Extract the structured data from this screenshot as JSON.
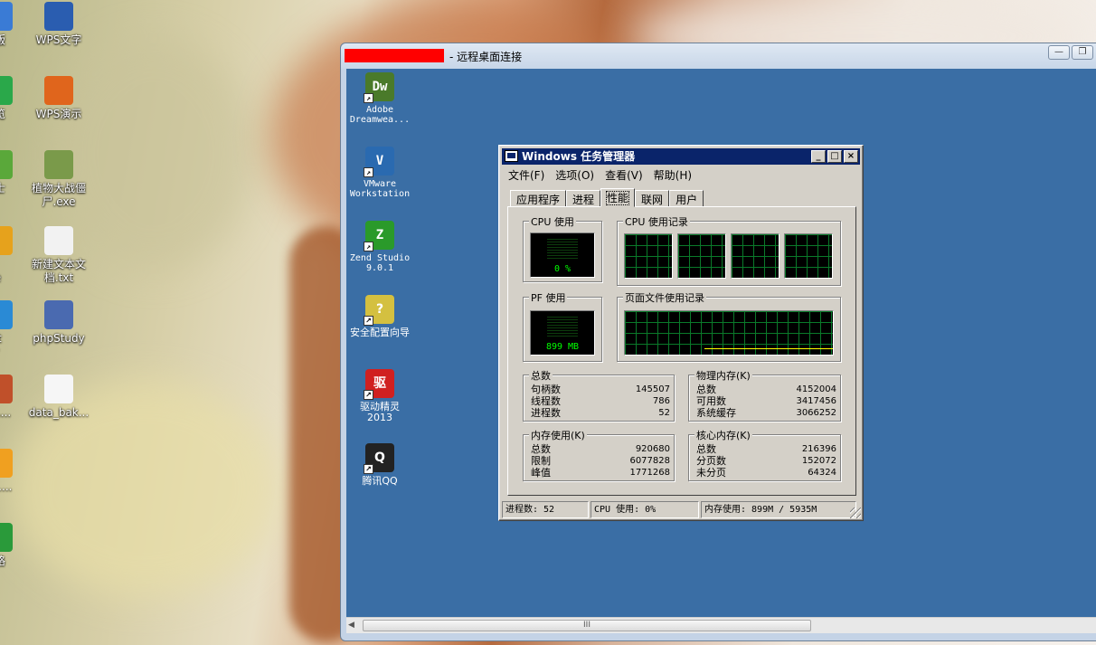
{
  "desktop": {
    "icons": [
      {
        "label": "简版",
        "color": "#3a7bd5"
      },
      {
        "label": "WPS文字",
        "color": "#2a5db0"
      },
      {
        "label": "浏览",
        "color": "#2aa84a"
      },
      {
        "label": "WPS演示",
        "color": "#e0651c"
      },
      {
        "label": "卫士",
        "color": "#5aa83a"
      },
      {
        "label": "植物大战僵尸.exe",
        "color": "#7a9a4a"
      },
      {
        "label": "ile me",
        "color": "#e6a21c"
      },
      {
        "label": "新建文本文档.txt",
        "color": "#f2f2f2"
      },
      {
        "label": "net rer",
        "color": "#2a8ad5"
      },
      {
        "label": "phpStudy",
        "color": "#4a6ab0"
      },
      {
        "label": "ne....",
        "color": "#c0502a"
      },
      {
        "label": "data_bak...",
        "color": "#f6f6f6"
      },
      {
        "label": "sic....",
        "color": "#f0a020"
      },
      {
        "label": "表格",
        "color": "#2a9a3a"
      }
    ]
  },
  "remote_window": {
    "title": "- 远程桌面连接",
    "buttons": {
      "min": "—",
      "max": "❐"
    },
    "icons": [
      {
        "label": "Adobe Dreamwea...",
        "glyph": "Dw",
        "color": "#4a7a2a"
      },
      {
        "label": "VMware Workstation",
        "glyph": "V",
        "color": "#2a6ab0"
      },
      {
        "label": "Zend Studio 9.0.1",
        "glyph": "Z",
        "color": "#2a9a2a"
      },
      {
        "label": "安全配置向导",
        "glyph": "?",
        "color": "#d4c040"
      },
      {
        "label": "驱动精灵 2013",
        "glyph": "驱",
        "color": "#d02020"
      },
      {
        "label": "腾讯QQ",
        "glyph": "Q",
        "color": "#222222"
      }
    ],
    "scroll_grip": "III"
  },
  "task_manager": {
    "title": "Windows 任务管理器",
    "buttons": {
      "min": "_",
      "max": "□",
      "close": "×"
    },
    "menu": [
      "文件(F)",
      "选项(O)",
      "查看(V)",
      "帮助(H)"
    ],
    "tabs": [
      "应用程序",
      "进程",
      "性能",
      "联网",
      "用户"
    ],
    "active_tab": "性能",
    "groups": {
      "cpu_usage": {
        "title": "CPU 使用",
        "value": "0 %"
      },
      "cpu_history": {
        "title": "CPU 使用记录"
      },
      "pf_usage": {
        "title": "PF 使用",
        "value": "899 MB"
      },
      "pf_history": {
        "title": "页面文件使用记录"
      }
    },
    "totals": {
      "title": "总数",
      "rows": [
        {
          "label": "句柄数",
          "value": "145507"
        },
        {
          "label": "线程数",
          "value": "786"
        },
        {
          "label": "进程数",
          "value": "52"
        }
      ]
    },
    "physical_memory": {
      "title": "物理内存(K)",
      "rows": [
        {
          "label": "总数",
          "value": "4152004"
        },
        {
          "label": "可用数",
          "value": "3417456"
        },
        {
          "label": "系统缓存",
          "value": "3066252"
        }
      ]
    },
    "commit_charge": {
      "title": "内存使用(K)",
      "rows": [
        {
          "label": "总数",
          "value": "920680"
        },
        {
          "label": "限制",
          "value": "6077828"
        },
        {
          "label": "峰值",
          "value": "1771268"
        }
      ]
    },
    "kernel_memory": {
      "title": "核心内存(K)",
      "rows": [
        {
          "label": "总数",
          "value": "216396"
        },
        {
          "label": "分页数",
          "value": "152072"
        },
        {
          "label": "未分页",
          "value": "64324"
        }
      ]
    },
    "status": {
      "processes": "进程数: 52",
      "cpu": "CPU 使用: 0%",
      "memory": "内存使用: 899M / 5935M"
    }
  }
}
